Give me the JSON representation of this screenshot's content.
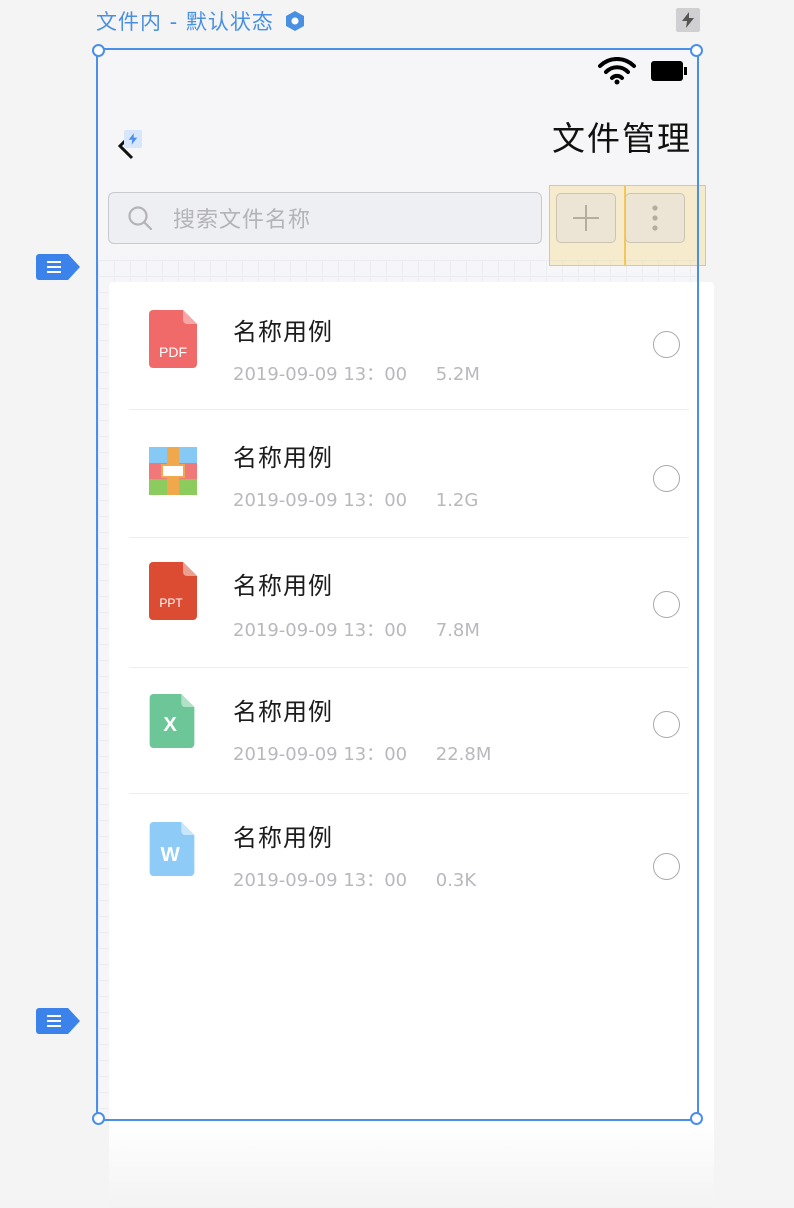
{
  "frame": {
    "label": "文件内 - 默认状态"
  },
  "nav": {
    "title": "文件管理"
  },
  "search": {
    "placeholder": "搜索文件名称"
  },
  "files": [
    {
      "type": "pdf",
      "icon_label": "PDF",
      "name": "名称用例",
      "date": "2019-09-09 13：00",
      "size": "5.2M",
      "color": "#f06a6a"
    },
    {
      "type": "zip",
      "icon_label": "",
      "name": "名称用例",
      "date": "2019-09-09 13：00",
      "size": "1.2G",
      "color": "#f1a74b"
    },
    {
      "type": "ppt",
      "icon_label": "PPT",
      "name": "名称用例",
      "date": "2019-09-09 13：00",
      "size": "7.8M",
      "color": "#db4c32"
    },
    {
      "type": "xls",
      "icon_label": "X",
      "name": "名称用例",
      "date": "2019-09-09 13：00",
      "size": "22.8M",
      "color": "#6cc697"
    },
    {
      "type": "doc",
      "icon_label": "W",
      "name": "名称用例",
      "date": "2019-09-09 13：00",
      "size": "0.3K",
      "color": "#8ecbf7"
    }
  ],
  "colors": {
    "accent": "#4a8fe8",
    "highlight": "#f3c85a"
  }
}
